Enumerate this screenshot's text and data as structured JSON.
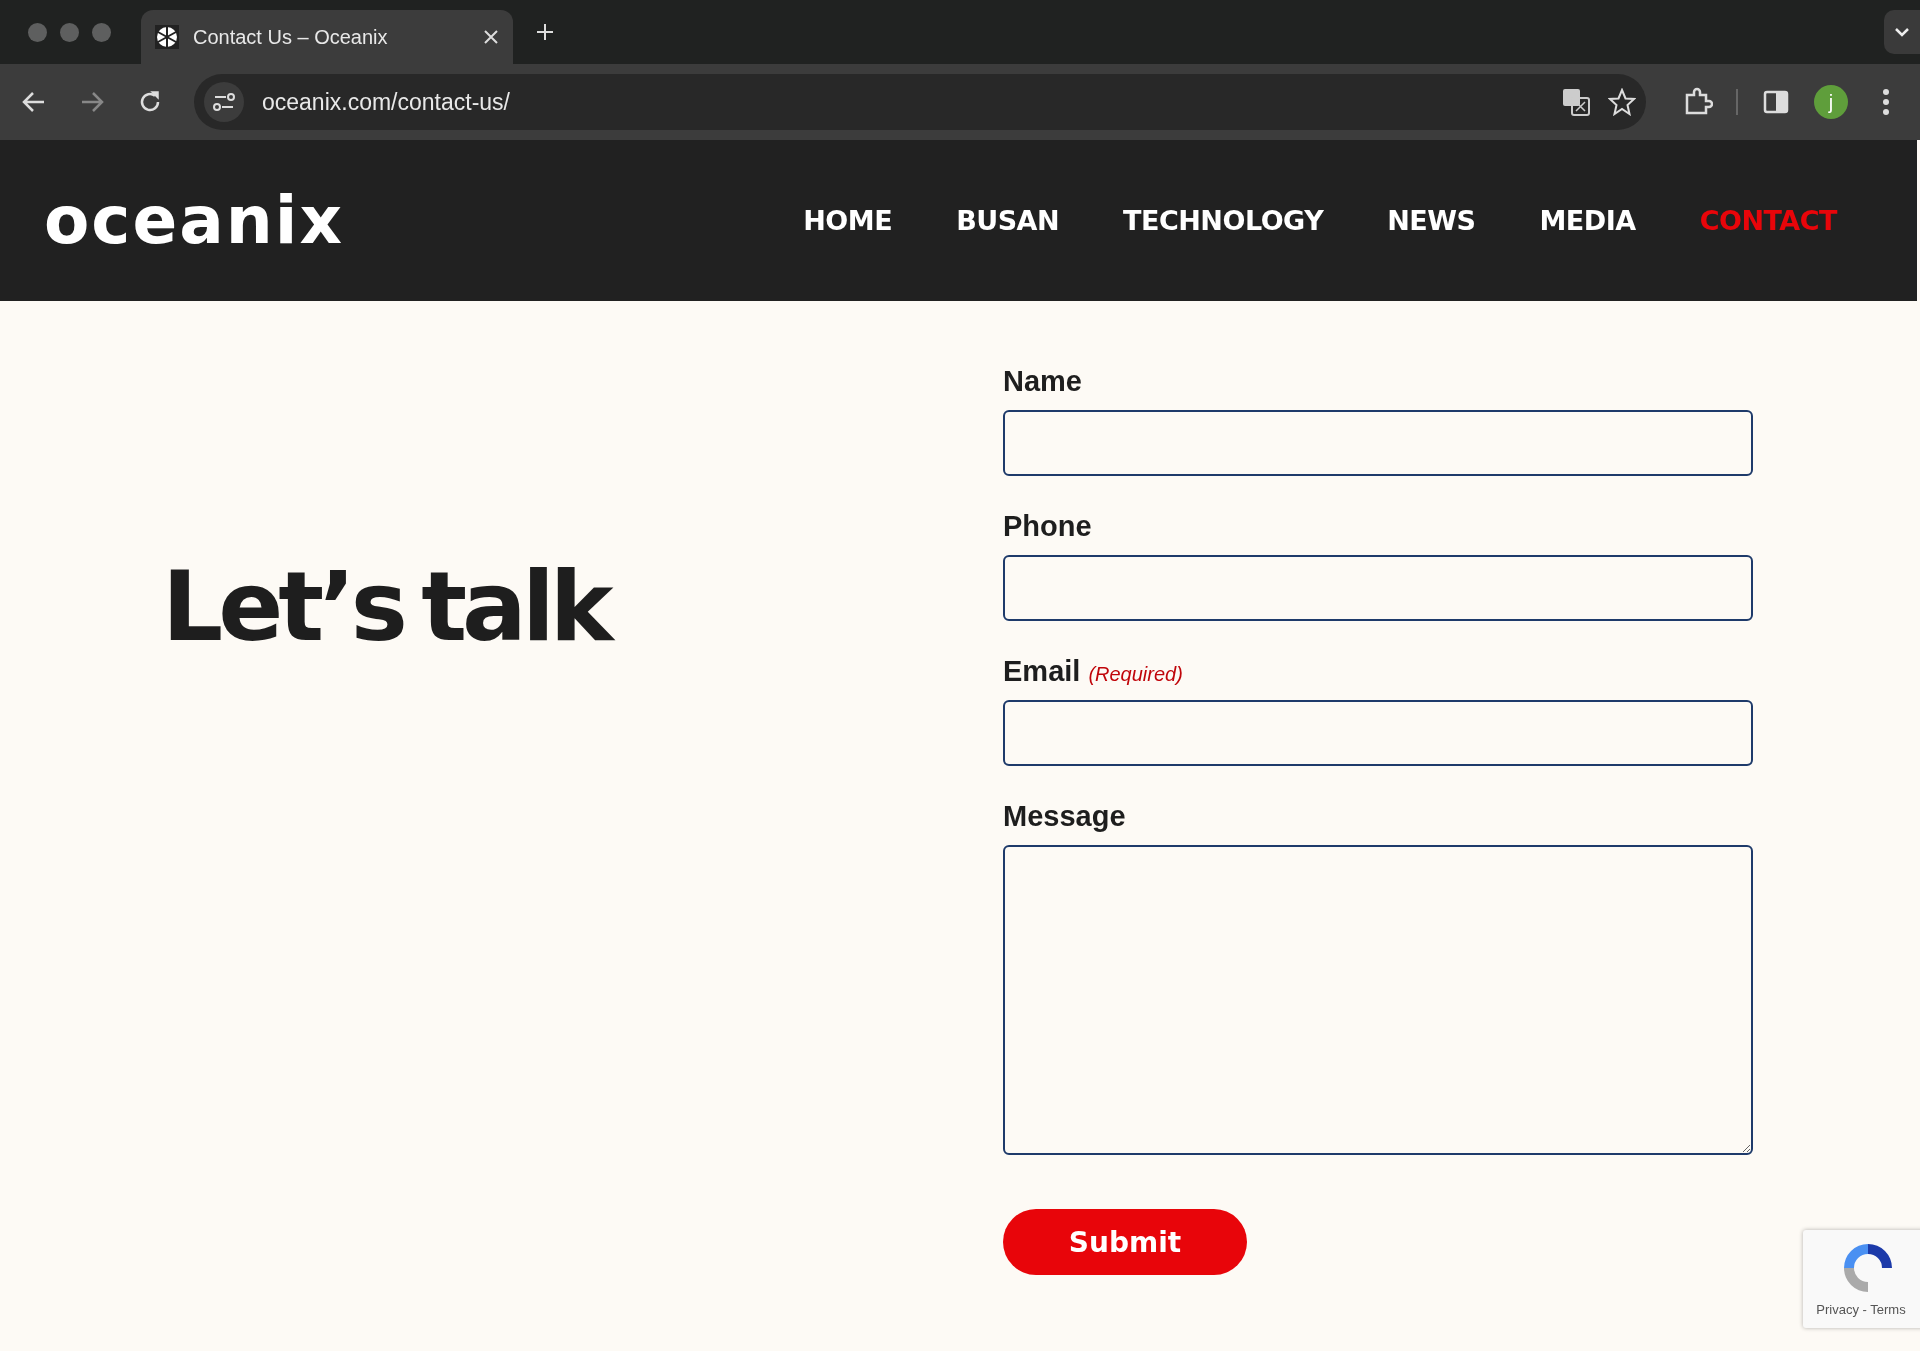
{
  "browser": {
    "tab_title": "Contact Us – Oceanix",
    "url": "oceanix.com/contact-us/",
    "profile_initial": "j"
  },
  "site": {
    "logo": "oceanix",
    "nav": [
      {
        "label": "HOME",
        "selected": false
      },
      {
        "label": "BUSAN",
        "selected": false
      },
      {
        "label": "TECHNOLOGY",
        "selected": false
      },
      {
        "label": "NEWS",
        "selected": false
      },
      {
        "label": "MEDIA",
        "selected": false
      },
      {
        "label": "CONTACT",
        "selected": true
      }
    ]
  },
  "heading": "Let’s talk",
  "form": {
    "fields": [
      {
        "label": "Name",
        "kind": "input"
      },
      {
        "label": "Phone",
        "kind": "input"
      },
      {
        "label": "Email",
        "required_note": "(Required)",
        "kind": "input"
      },
      {
        "label": "Message",
        "kind": "textarea"
      }
    ],
    "submit": "Submit"
  },
  "recaptcha": {
    "links": "Privacy - Terms"
  }
}
